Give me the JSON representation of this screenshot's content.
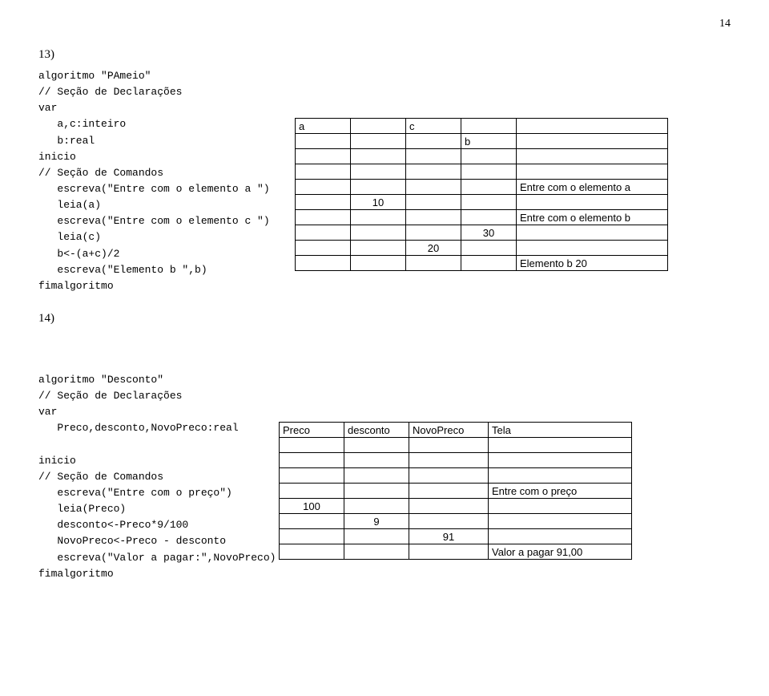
{
  "page_number": "14",
  "ex1": {
    "number": "13)",
    "code": {
      "l0": "algoritmo \"PAmeio\"",
      "l1": "// Seção de Declarações",
      "l2": "var",
      "l3": "   a,c:inteiro",
      "l4": "   b:real",
      "l5": "inicio",
      "l6": "// Seção de Comandos",
      "l7": "   escreva(\"Entre com o elemento a \")",
      "l8": "   leia(a)",
      "l9": "   escreva(\"Entre com o elemento c \")",
      "l10": "   leia(c)",
      "l11": "   b<-(a+c)/2",
      "l12": "   escreva(\"Elemento b \",b)",
      "l13": "fimalgoritmo"
    },
    "trace": {
      "header_a": "a",
      "header_c": "c",
      "header_b": "b",
      "msg1": "Entre com o elemento a",
      "a_val": "10",
      "msg2": "Entre com o elemento b",
      "c_val": "30",
      "b_val": "20",
      "msg3": "Elemento b 20"
    }
  },
  "ex2": {
    "number": "14)",
    "code": {
      "l0": "algoritmo \"Desconto\"",
      "l1": "// Seção de Declarações",
      "l2": "var",
      "l3": "   Preco,desconto,NovoPreco:real",
      "l5": "inicio",
      "l6": "// Seção de Comandos",
      "l7": "   escreva(\"Entre com o preço\")",
      "l8": "   leia(Preco)",
      "l9": "   desconto<-Preco*9/100",
      "l10": "   NovoPreco<-Preco - desconto",
      "l11": "   escreva(\"Valor a pagar:\",NovoPreco)",
      "l12": "fimalgoritmo"
    },
    "trace": {
      "h1": "Preco",
      "h2": "desconto",
      "h3": "NovoPreco",
      "h4": "Tela",
      "msg1": "Entre com o preço",
      "preco": "100",
      "desconto": "9",
      "novo": "91",
      "msg2": "Valor a pagar 91,00"
    }
  }
}
